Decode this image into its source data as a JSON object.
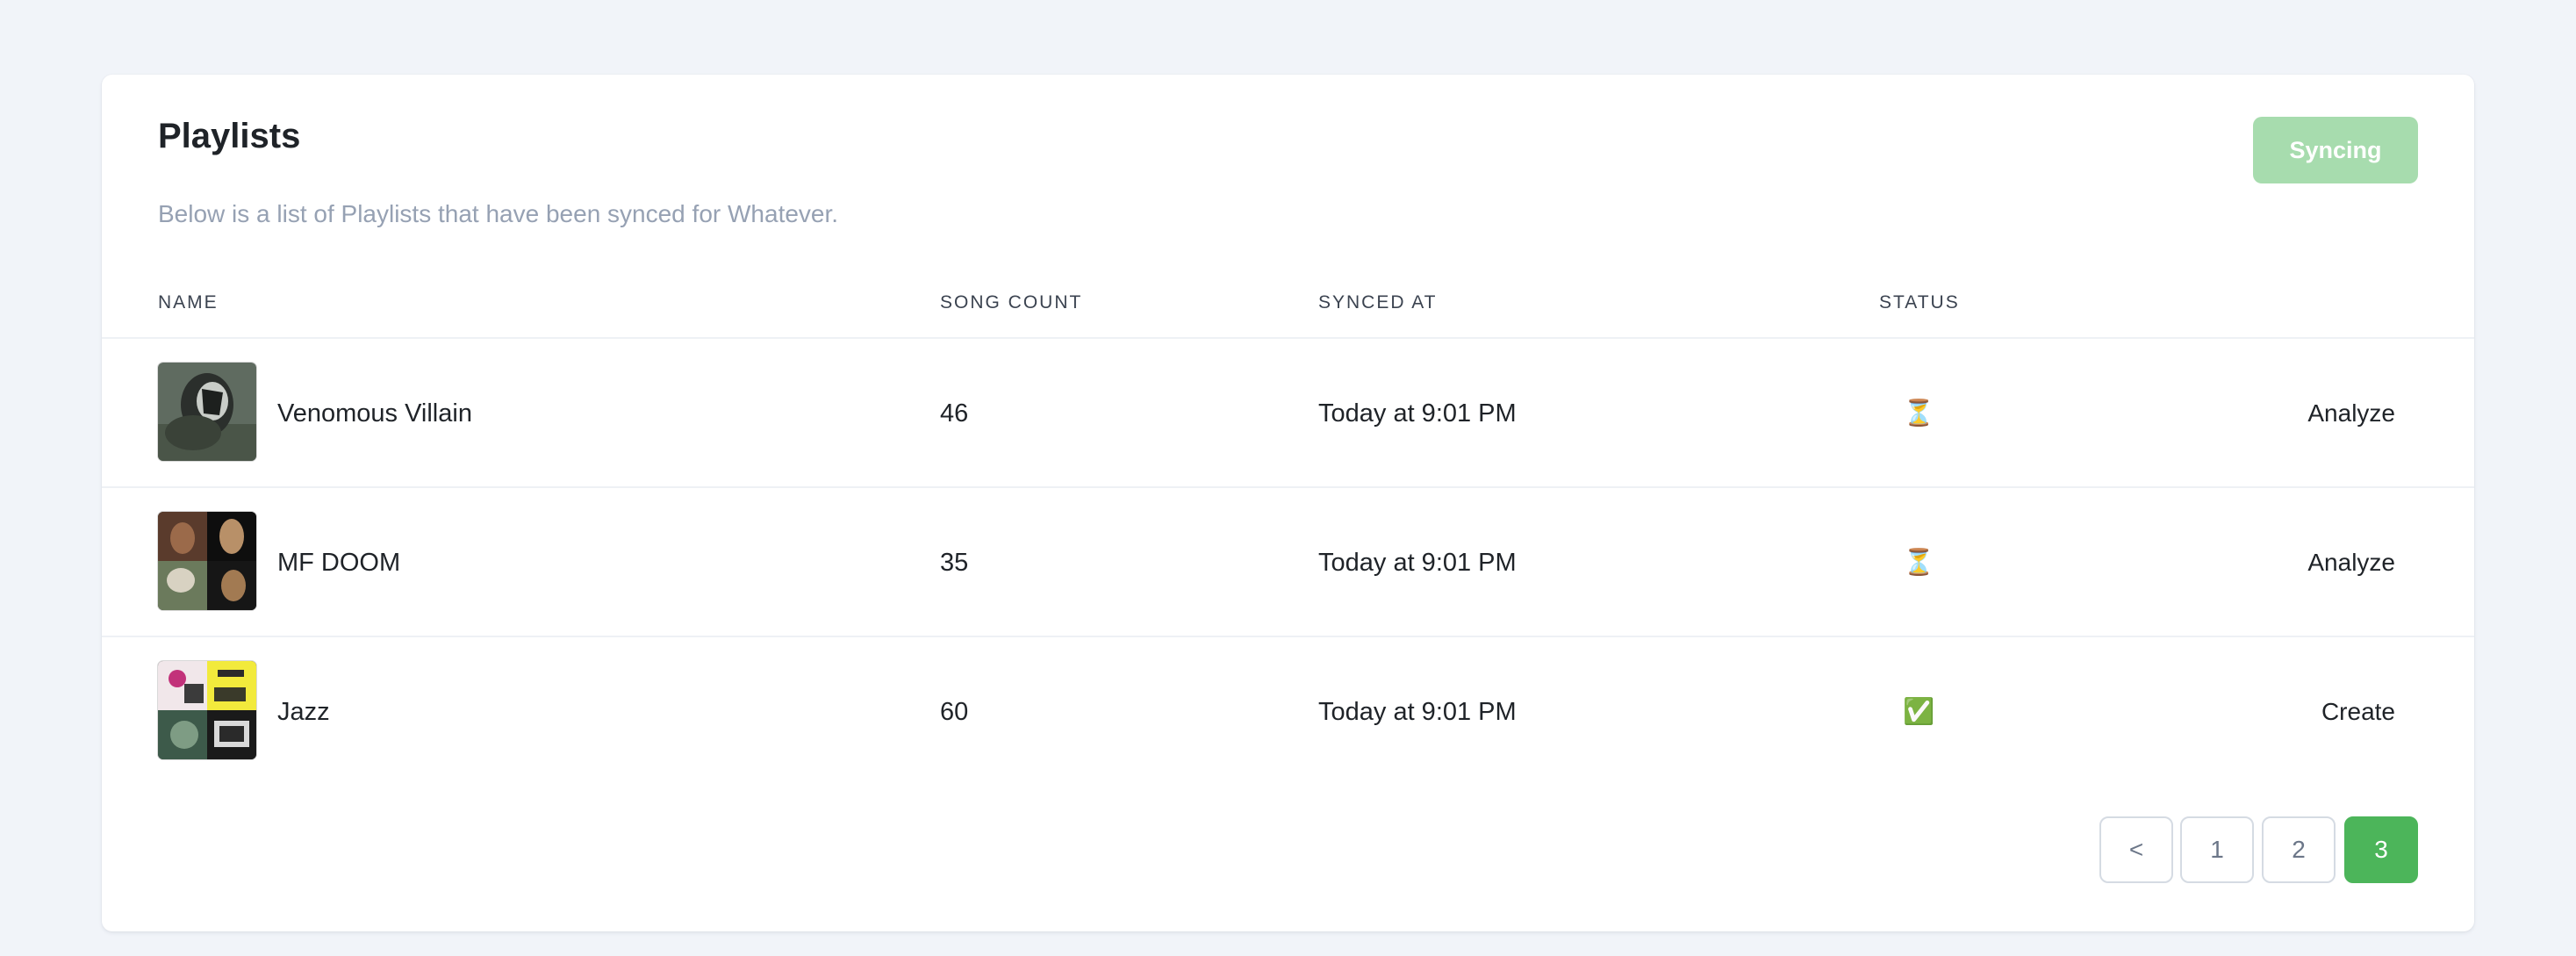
{
  "header": {
    "title": "Playlists",
    "subtitle": "Below is a list of Playlists that have been synced for Whatever.",
    "sync_button": "Syncing"
  },
  "table": {
    "columns": [
      "NAME",
      "SONG COUNT",
      "SYNCED AT",
      "STATUS"
    ],
    "rows": [
      {
        "name": "Venomous Villain",
        "song_count": "46",
        "synced_at": "Today at 9:01 PM",
        "status_icon": "⏳",
        "status_name": "hourglass-icon",
        "action": "Analyze"
      },
      {
        "name": "MF DOOM",
        "song_count": "35",
        "synced_at": "Today at 9:01 PM",
        "status_icon": "⏳",
        "status_name": "hourglass-icon",
        "action": "Analyze"
      },
      {
        "name": "Jazz",
        "song_count": "60",
        "synced_at": "Today at 9:01 PM",
        "status_icon": "✅",
        "status_name": "check-mark-icon",
        "action": "Create"
      }
    ]
  },
  "pagination": {
    "prev": "<",
    "pages": [
      "1",
      "2",
      "3"
    ],
    "current": "3"
  },
  "colors": {
    "accent": "#4cb55a",
    "accent_disabled": "#a7dcae",
    "muted_text": "#96a1b3",
    "background": "#f1f4f9"
  }
}
